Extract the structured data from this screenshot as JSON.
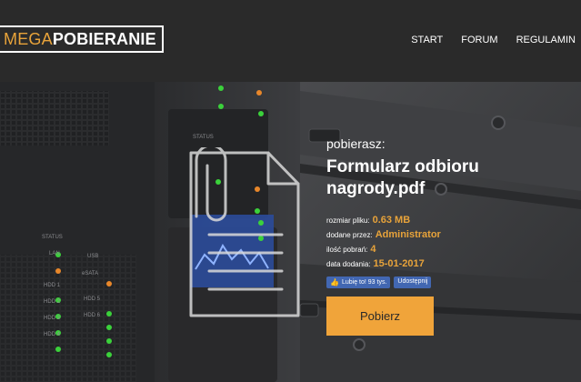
{
  "header": {
    "logo_thin": "MEGA",
    "logo_bold": "POBIERANIE",
    "nav": [
      "START",
      "FORUM",
      "REGULAMIN"
    ]
  },
  "server_labels": {
    "status": "STATUS",
    "lan": "LAN",
    "usb": "USB",
    "esata": "eSATA",
    "hdd": [
      "HDD 1",
      "HDD 2",
      "HDD 3",
      "HDD 4",
      "HDD 5",
      "HDD 6"
    ]
  },
  "main": {
    "downloading_label": "pobierasz:",
    "file_title": "Formularz odbioru nagrody.pdf",
    "meta": [
      {
        "label": "rozmiar pliku:",
        "value": "0.63 MB"
      },
      {
        "label": "dodane przez:",
        "value": "Administrator"
      },
      {
        "label": "ilość pobrań:",
        "value": "4"
      },
      {
        "label": "data dodania:",
        "value": "15-01-2017"
      }
    ],
    "fb_like": "Lubię to! 93 tys.",
    "fb_share": "Udostępnij",
    "download_label": "Pobierz"
  },
  "colors": {
    "accent": "#e8a33a",
    "button": "#f0a43a",
    "header_bg": "#2a2a2a",
    "fb_blue": "#4267b2",
    "led_green": "#3bd13b",
    "led_orange": "#e8872a"
  }
}
